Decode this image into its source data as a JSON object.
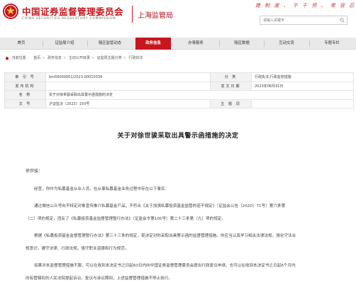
{
  "header": {
    "org_cn": "中国证券监督管理委员会",
    "org_en": "CHINA SECURITIES REGULATORY COMMISSION",
    "bureau": "上海监管局",
    "slogan": "建 制 度 、 不 干 预 、 零 容 忍",
    "search_placeholder": "请输入关键字"
  },
  "nav": {
    "items": [
      {
        "label": "首页"
      },
      {
        "label": "证监局介绍"
      },
      {
        "label": "辖区监管动态"
      },
      {
        "label": "政务信息",
        "active": true
      },
      {
        "label": "办事服务"
      },
      {
        "label": "辖区数据"
      },
      {
        "label": "互动交流"
      },
      {
        "label": "专题专栏"
      }
    ]
  },
  "breadcrumb": [
    "当前位置",
    "首页",
    "政务信息",
    "主动公开目录",
    "证监局主题分类",
    "行政执法"
  ],
  "info": {
    "index_label": "索 引 号",
    "index_value": "bm56000001/2023-00010039",
    "category_label": "分 类",
    "category_value": "行政执法;行政监管措施",
    "issuer_label": "发布机构",
    "issuer_value": "",
    "date_label": "发文日期",
    "date_value": "2023年08月31日",
    "name_label": "名 称",
    "name_value": "关于对徐世骏采取出具警示函措施的决定",
    "doc_label": "文 号",
    "doc_value": "沪证监决〔2023〕150号",
    "subject_label": "主 题 词",
    "subject_value": ""
  },
  "document": {
    "title": "关于对徐世骏采取出具警示函措施的决定",
    "salutation": "徐世骏：",
    "lines": [
      "经查，你作为私募基金从业人员，在从事私募基金业务过程中存在以下事实：",
      "通过微信公众号向不特定对象宣传推介私募基金产品，不符合《关于加强私募投资基金监管的若干规定》（证监会公告〔2020〕71号）第六条第",
      "（二）项的规定，违反了《私募投资基金监督管理暂行办法》（证监会令第105号）第二十三条第（九）项的规定。",
      "根据《私募投资基金监督管理暂行办法》第三十三条的规定，现决定对你采取出具警示函的监督管理措施。你应当认真学习相关法律法规，强化守法合",
      "规意识，遵守法律、行政法规，恪守职业道德和行为规范。",
      "如果对本监督管理措施不服，可以在收到本决定书之日起60日内向中国证券监督管理委员会提出行政复议申请，也可以在收到本决定书之日起6个月内",
      "向有管辖权的人民法院提起诉讼。复议与诉讼期间，上述监督管理措施不停止执行。"
    ]
  },
  "colors": {
    "brand_red": "#c8161d",
    "nav_bg": "#e9e9e9",
    "label_bg": "#f2f2f2"
  }
}
